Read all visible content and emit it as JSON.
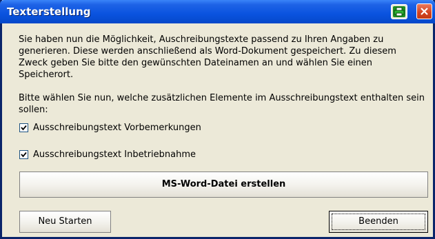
{
  "window": {
    "title": "Texterstellung",
    "icons": [
      "print-icon",
      "close-icon"
    ],
    "colors": {
      "titlebar": "#0A53DF",
      "window_bg": "#ECE9D8",
      "close": "#D2411E",
      "print": "#1B8E21"
    }
  },
  "intro": {
    "text": "Sie haben nun die Möglichkeit, Auschreibungstexte passend zu Ihren Angaben zu generieren. Diese werden anschließend als Word-Dokument gespeichert. Zu diesem Zweck geben Sie bitte den gewünschten Dateinamen an und wählen Sie einen Speicherort."
  },
  "elements_prompt": "Bitte wählen Sie nun, welche zusätzlichen Elemente im Ausschreibungstext enthalten sein sollen:",
  "options": [
    {
      "label": "Ausschreibungstext Vorbemerkungen",
      "checked": true
    },
    {
      "label": "Ausschreibungstext Inbetriebnahme",
      "checked": true
    }
  ],
  "buttons": {
    "create": "MS-Word-Datei erstellen",
    "restart": "Neu Starten",
    "exit": "Beenden"
  }
}
